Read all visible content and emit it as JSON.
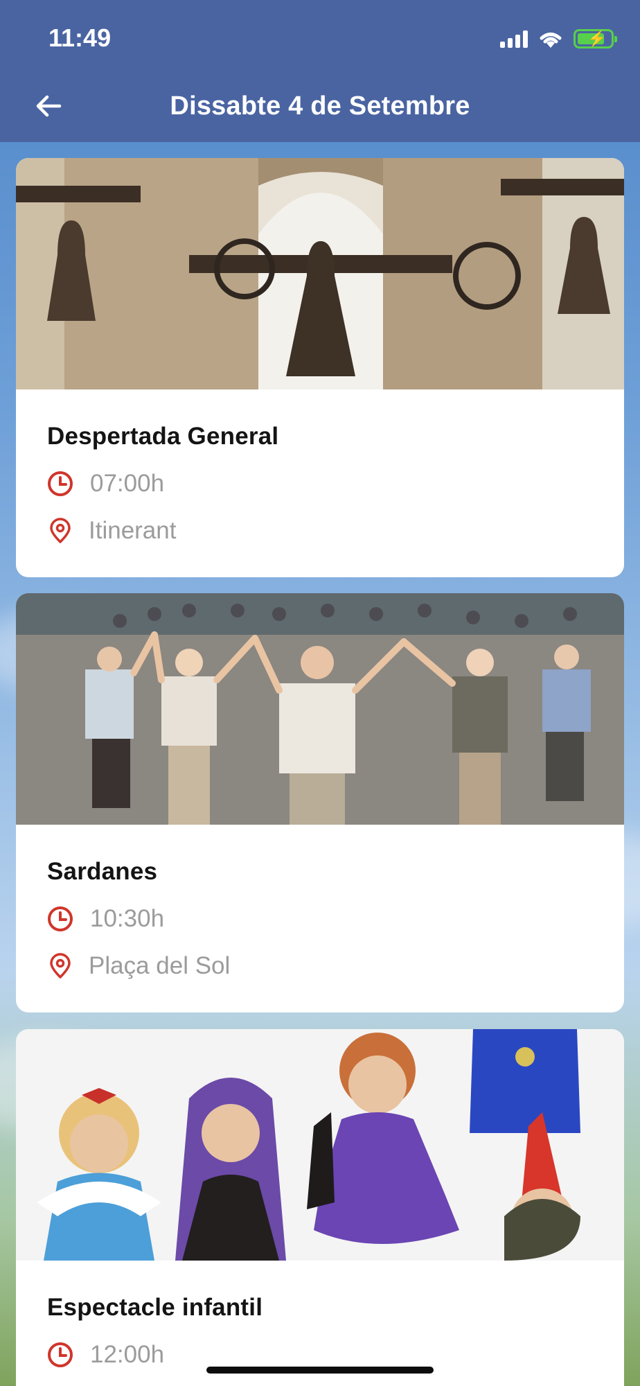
{
  "status_bar": {
    "time": "11:49"
  },
  "header": {
    "title": "Dissabte 4 de Setembre"
  },
  "colors": {
    "header": "#4a64a2",
    "accent": "#d0352b"
  },
  "events": [
    {
      "title": "Despertada General",
      "time": "07:00h",
      "location": "Itinerant"
    },
    {
      "title": "Sardanes",
      "time": "10:30h",
      "location": "Plaça del Sol"
    },
    {
      "title": "Espectacle infantil",
      "time": "12:00h"
    }
  ]
}
